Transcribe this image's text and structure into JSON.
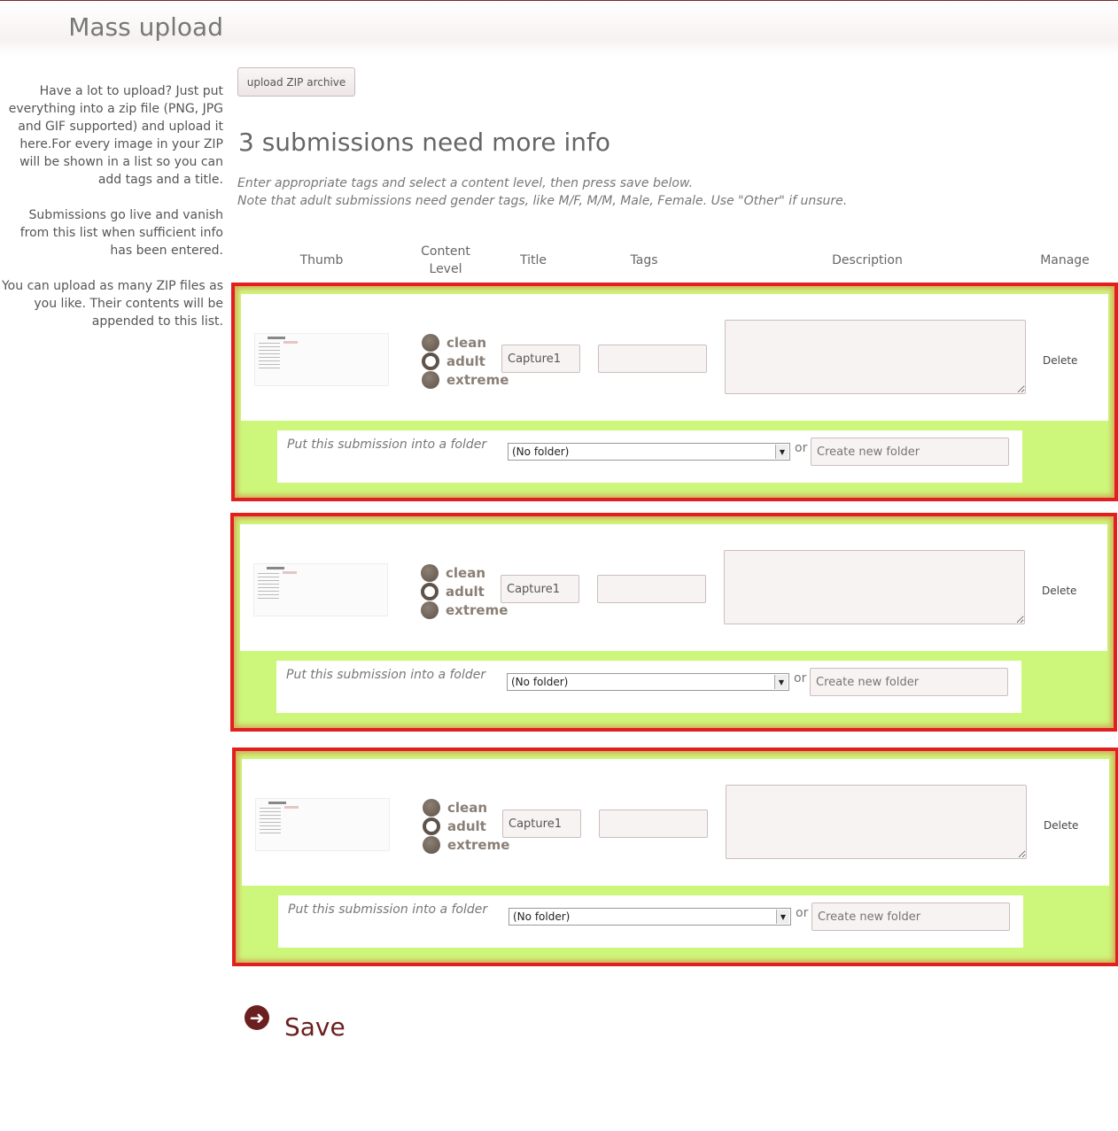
{
  "page": {
    "title": "Mass upload"
  },
  "sidebar": {
    "paragraphs": [
      "Have a lot to upload? Just put everything into a zip file (PNG, JPG and GIF supported) and upload it here.For every image in your ZIP will be shown in a list so you can add tags and a title.",
      "Submissions go live and vanish from this list when sufficient info has been entered.",
      "You can upload as many ZIP files as you like. Their contents will be appended to this list."
    ]
  },
  "upload_button": "upload ZIP archive",
  "headline": "3 submissions need more info",
  "instructions": {
    "line1": "Enter appropriate tags and select a content level, then press save below.",
    "line2": "Note that adult submissions need gender tags, like M/F, M/M, Male, Female. Use \"Other\" if unsure."
  },
  "columns": {
    "thumb": "Thumb",
    "content_level_1": "Content",
    "content_level_2": "Level",
    "title": "Title",
    "tags": "Tags",
    "description": "Description",
    "manage": "Manage"
  },
  "content_levels": [
    "clean",
    "adult",
    "extreme"
  ],
  "selected_level": "adult",
  "submissions": [
    {
      "title": "Capture1",
      "tags": "",
      "description": "",
      "delete": "Delete",
      "folder_label": "Put this submission into a folder",
      "folder_selected": "(No folder)",
      "or": "or",
      "new_folder_placeholder": "Create new folder"
    },
    {
      "title": "Capture1",
      "tags": "",
      "description": "",
      "delete": "Delete",
      "folder_label": "Put this submission into a folder",
      "folder_selected": "(No folder)",
      "or": "or",
      "new_folder_placeholder": "Create new folder"
    },
    {
      "title": "Capture1",
      "tags": "",
      "description": "",
      "delete": "Delete",
      "folder_label": "Put this submission into a folder",
      "folder_selected": "(No folder)",
      "or": "or",
      "new_folder_placeholder": "Create new folder"
    }
  ],
  "save_label": "Save",
  "colors": {
    "highlight_border": "#e21f1f",
    "highlight_fill": "#cdf77a",
    "accent": "#6b1f1f"
  }
}
